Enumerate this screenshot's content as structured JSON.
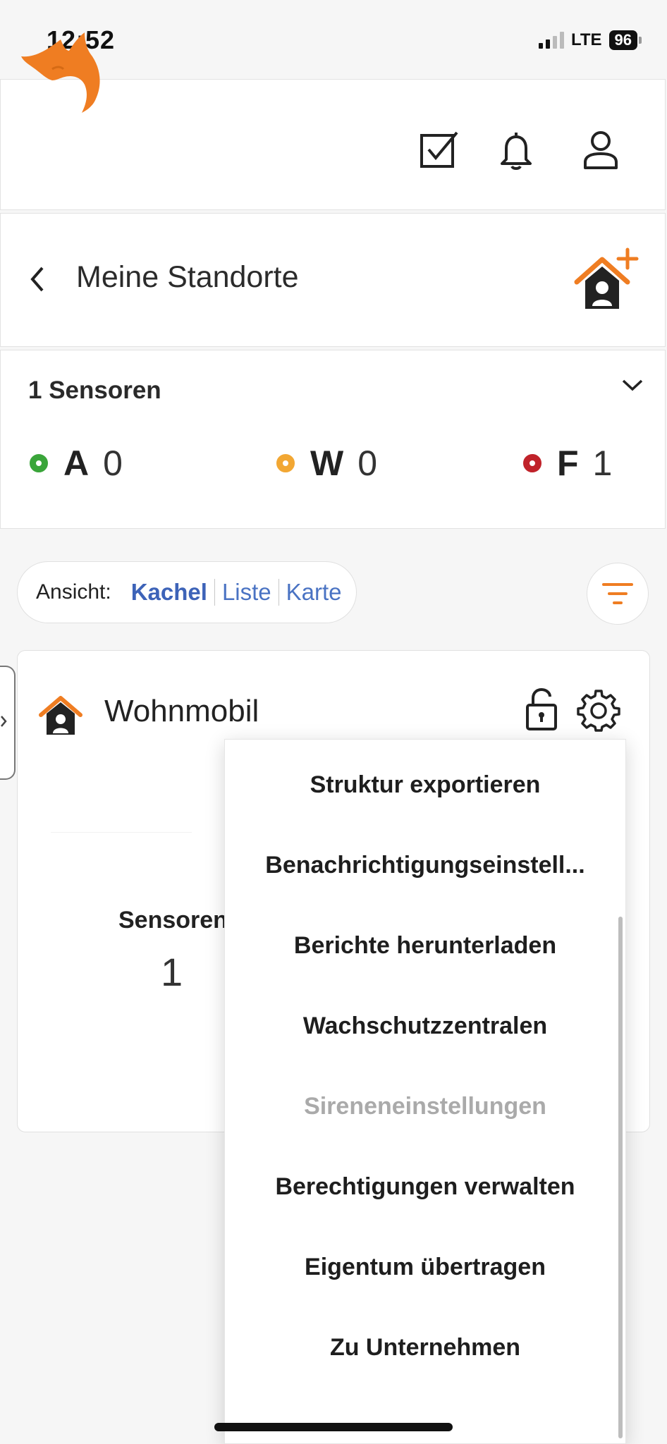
{
  "status_bar": {
    "time": "12:52",
    "network": "LTE",
    "battery": "96"
  },
  "header": {
    "logo": "fox-logo",
    "icons": [
      "checklist-icon",
      "bell-icon",
      "user-icon"
    ],
    "brand_color": "#ef7d22"
  },
  "title_bar": {
    "title": "Meine Standorte",
    "add_location_icon": "add-location-icon"
  },
  "sensors_summary": {
    "title": "1 Sensoren",
    "statuses": [
      {
        "letter": "A",
        "count": "0",
        "color": "#3aa53a"
      },
      {
        "letter": "W",
        "count": "0",
        "color": "#f2a733"
      },
      {
        "letter": "F",
        "count": "1",
        "color": "#c0222a"
      }
    ]
  },
  "view": {
    "label": "Ansicht:",
    "options": [
      "Kachel",
      "Liste",
      "Karte"
    ],
    "active": "Kachel"
  },
  "location": {
    "name": "Wohnmobil",
    "sensors_label": "Sensoren",
    "sensors_value": "1"
  },
  "menu": {
    "items": [
      {
        "label": "Struktur exportieren",
        "enabled": true
      },
      {
        "label": "Benachrichtigungseinstell...",
        "enabled": true
      },
      {
        "label": "Berichte herunterladen",
        "enabled": true
      },
      {
        "label": "Wachschutzzentralen",
        "enabled": true
      },
      {
        "label": "Sireneneinstellungen",
        "enabled": false
      },
      {
        "label": "Berechtigungen verwalten",
        "enabled": true
      },
      {
        "label": "Eigentum übertragen",
        "enabled": true
      },
      {
        "label": "Zu Unternehmen",
        "enabled": true
      }
    ]
  }
}
